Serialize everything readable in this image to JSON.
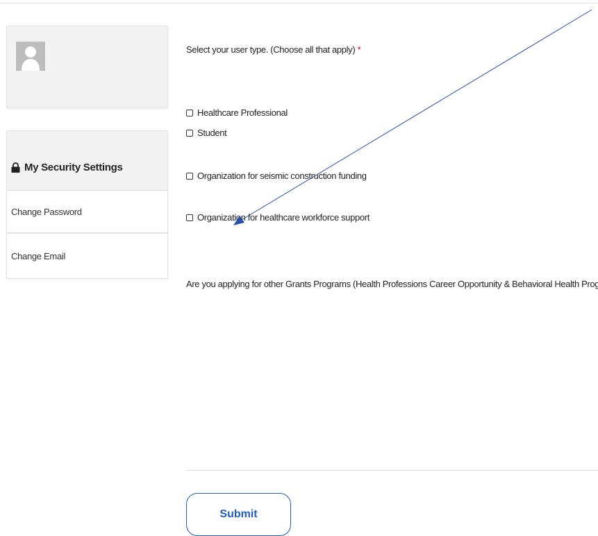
{
  "sidebar": {
    "security_title": "My Security Settings",
    "items": [
      {
        "label": "Change Password"
      },
      {
        "label": "Change Email"
      }
    ]
  },
  "form": {
    "user_type_question": "Select your user type. (Choose all that apply)",
    "required_marker": "*",
    "options": [
      {
        "label": "Healthcare Professional",
        "checked": false
      },
      {
        "label": "Student",
        "checked": false
      },
      {
        "label": "Organization for seismic construction funding",
        "checked": false
      },
      {
        "label": "Organization for healthcare workforce support",
        "checked": false
      }
    ],
    "grants_question": "Are you applying for other Grants Programs (Health Professions Career Opportunity & Behavioral Health Programs)?",
    "submit_label": "Submit"
  },
  "icons": {
    "avatar": "user-silhouette-icon",
    "lock": "lock-icon"
  },
  "colors": {
    "accent": "#1f5fb8",
    "required": "#cc0000",
    "annotation_arrow": "#2b4fa8"
  }
}
